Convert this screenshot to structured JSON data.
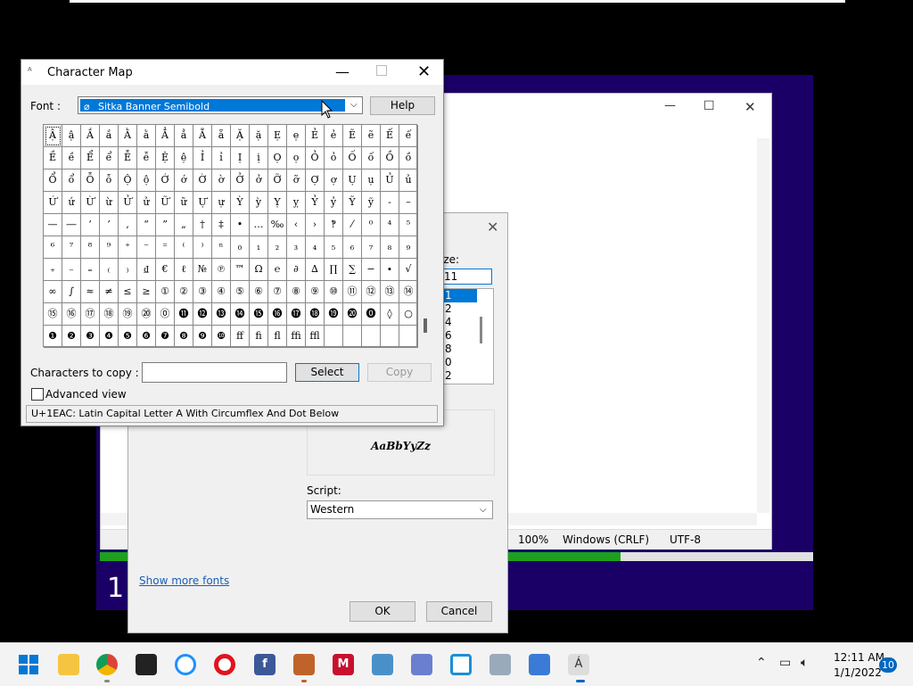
{
  "background_window": {
    "number": "1"
  },
  "notepad": {
    "status": {
      "zoom": "100%",
      "line_ending": "Windows (CRLF)",
      "encoding": "UTF-8"
    },
    "progress": 0.73
  },
  "font_dialog": {
    "size_label": "ize:",
    "size_value": "11",
    "size_list": [
      "1",
      "2",
      "4",
      "6",
      "8",
      "0",
      "2"
    ],
    "sample_text": "AaBbYyZz",
    "script_label": "Script:",
    "script_value": "Western",
    "show_more": "Show more fonts",
    "ok": "OK",
    "cancel": "Cancel"
  },
  "charmap": {
    "title": "Character Map",
    "font_label": "Font :",
    "font_value": "Sitka Banner Semibold",
    "help": "Help",
    "copy_label": "Characters to copy :",
    "copy_value": "",
    "select": "Select",
    "copy": "Copy",
    "advanced": "Advanced view",
    "status": "U+1EAC: Latin Capital Letter A With Circumflex And Dot Below",
    "grid": [
      [
        "Ậ",
        "ậ",
        "Ắ",
        "ắ",
        "Ằ",
        "ằ",
        "Ẳ",
        "ẳ",
        "Ẵ",
        "ẵ",
        "Ặ",
        "ặ",
        "Ẹ",
        "ẹ",
        "Ẻ",
        "ẻ",
        "Ẽ",
        "ẽ",
        "Ế",
        "ế"
      ],
      [
        "Ề",
        "ề",
        "Ể",
        "ể",
        "Ễ",
        "ễ",
        "Ệ",
        "ệ",
        "Ỉ",
        "ỉ",
        "Ị",
        "ị",
        "Ọ",
        "ọ",
        "Ỏ",
        "ỏ",
        "Ố",
        "ố",
        "Ồ",
        "ồ"
      ],
      [
        "Ổ",
        "ổ",
        "Ỗ",
        "ỗ",
        "Ộ",
        "ộ",
        "Ớ",
        "ớ",
        "Ờ",
        "ờ",
        "Ở",
        "ở",
        "Ỡ",
        "ỡ",
        "Ợ",
        "ợ",
        "Ụ",
        "ụ",
        "Ủ",
        "ủ"
      ],
      [
        "Ứ",
        "ứ",
        "Ừ",
        "ừ",
        "Ử",
        "ử",
        "Ữ",
        "ữ",
        "Ự",
        "ự",
        "Ỳ",
        "ỳ",
        "Ỵ",
        "ỵ",
        "Ỷ",
        "ỷ",
        "Ỹ",
        "ỹ",
        "‐",
        "–"
      ],
      [
        "—",
        "―",
        "‘",
        "’",
        "‚",
        "“",
        "”",
        "„",
        "†",
        "‡",
        "•",
        "…",
        "‰",
        "‹",
        "›",
        "‽",
        "⁄",
        "⁰",
        "⁴",
        "⁵"
      ],
      [
        "⁶",
        "⁷",
        "⁸",
        "⁹",
        "⁺",
        "⁻",
        "⁼",
        "⁽",
        "⁾",
        "ⁿ",
        "₀",
        "₁",
        "₂",
        "₃",
        "₄",
        "₅",
        "₆",
        "₇",
        "₈",
        "₉"
      ],
      [
        "₊",
        "₋",
        "₌",
        "₍",
        "₎",
        "₫",
        "€",
        "ℓ",
        "№",
        "℗",
        "™",
        "Ω",
        "℮",
        "∂",
        "∆",
        "∏",
        "∑",
        "−",
        "∙",
        "√"
      ],
      [
        "∞",
        "∫",
        "≈",
        "≠",
        "≤",
        "≥",
        "①",
        "②",
        "③",
        "④",
        "⑤",
        "⑥",
        "⑦",
        "⑧",
        "⑨",
        "⑩",
        "⑪",
        "⑫",
        "⑬",
        "⑭"
      ],
      [
        "⑮",
        "⑯",
        "⑰",
        "⑱",
        "⑲",
        "⑳",
        "⓪",
        "⓫",
        "⓬",
        "⓭",
        "⓮",
        "⓯",
        "⓰",
        "⓱",
        "⓲",
        "⓳",
        "⓴",
        "⓿",
        "◊",
        "○"
      ],
      [
        "❶",
        "❷",
        "❸",
        "❹",
        "❺",
        "❻",
        "❼",
        "❽",
        "❾",
        "❿",
        "ﬀ",
        "ﬁ",
        "ﬂ",
        "ﬃ",
        "ﬄ",
        "",
        "",
        "",
        "",
        ""
      ]
    ]
  },
  "taskbar": {
    "icons": [
      "windows-start-icon",
      "file-explorer-icon",
      "chrome-icon",
      "store-icon",
      "browser-icon",
      "opera-icon",
      "facebook-icon",
      "game-icon",
      "mcafee-icon",
      "control-panel-icon",
      "system-icon",
      "window-icon",
      "monitor-icon",
      "notepad-icon",
      "charmap-icon"
    ],
    "time": "12:11 AM",
    "date": "1/1/2022",
    "notifications": "10"
  }
}
